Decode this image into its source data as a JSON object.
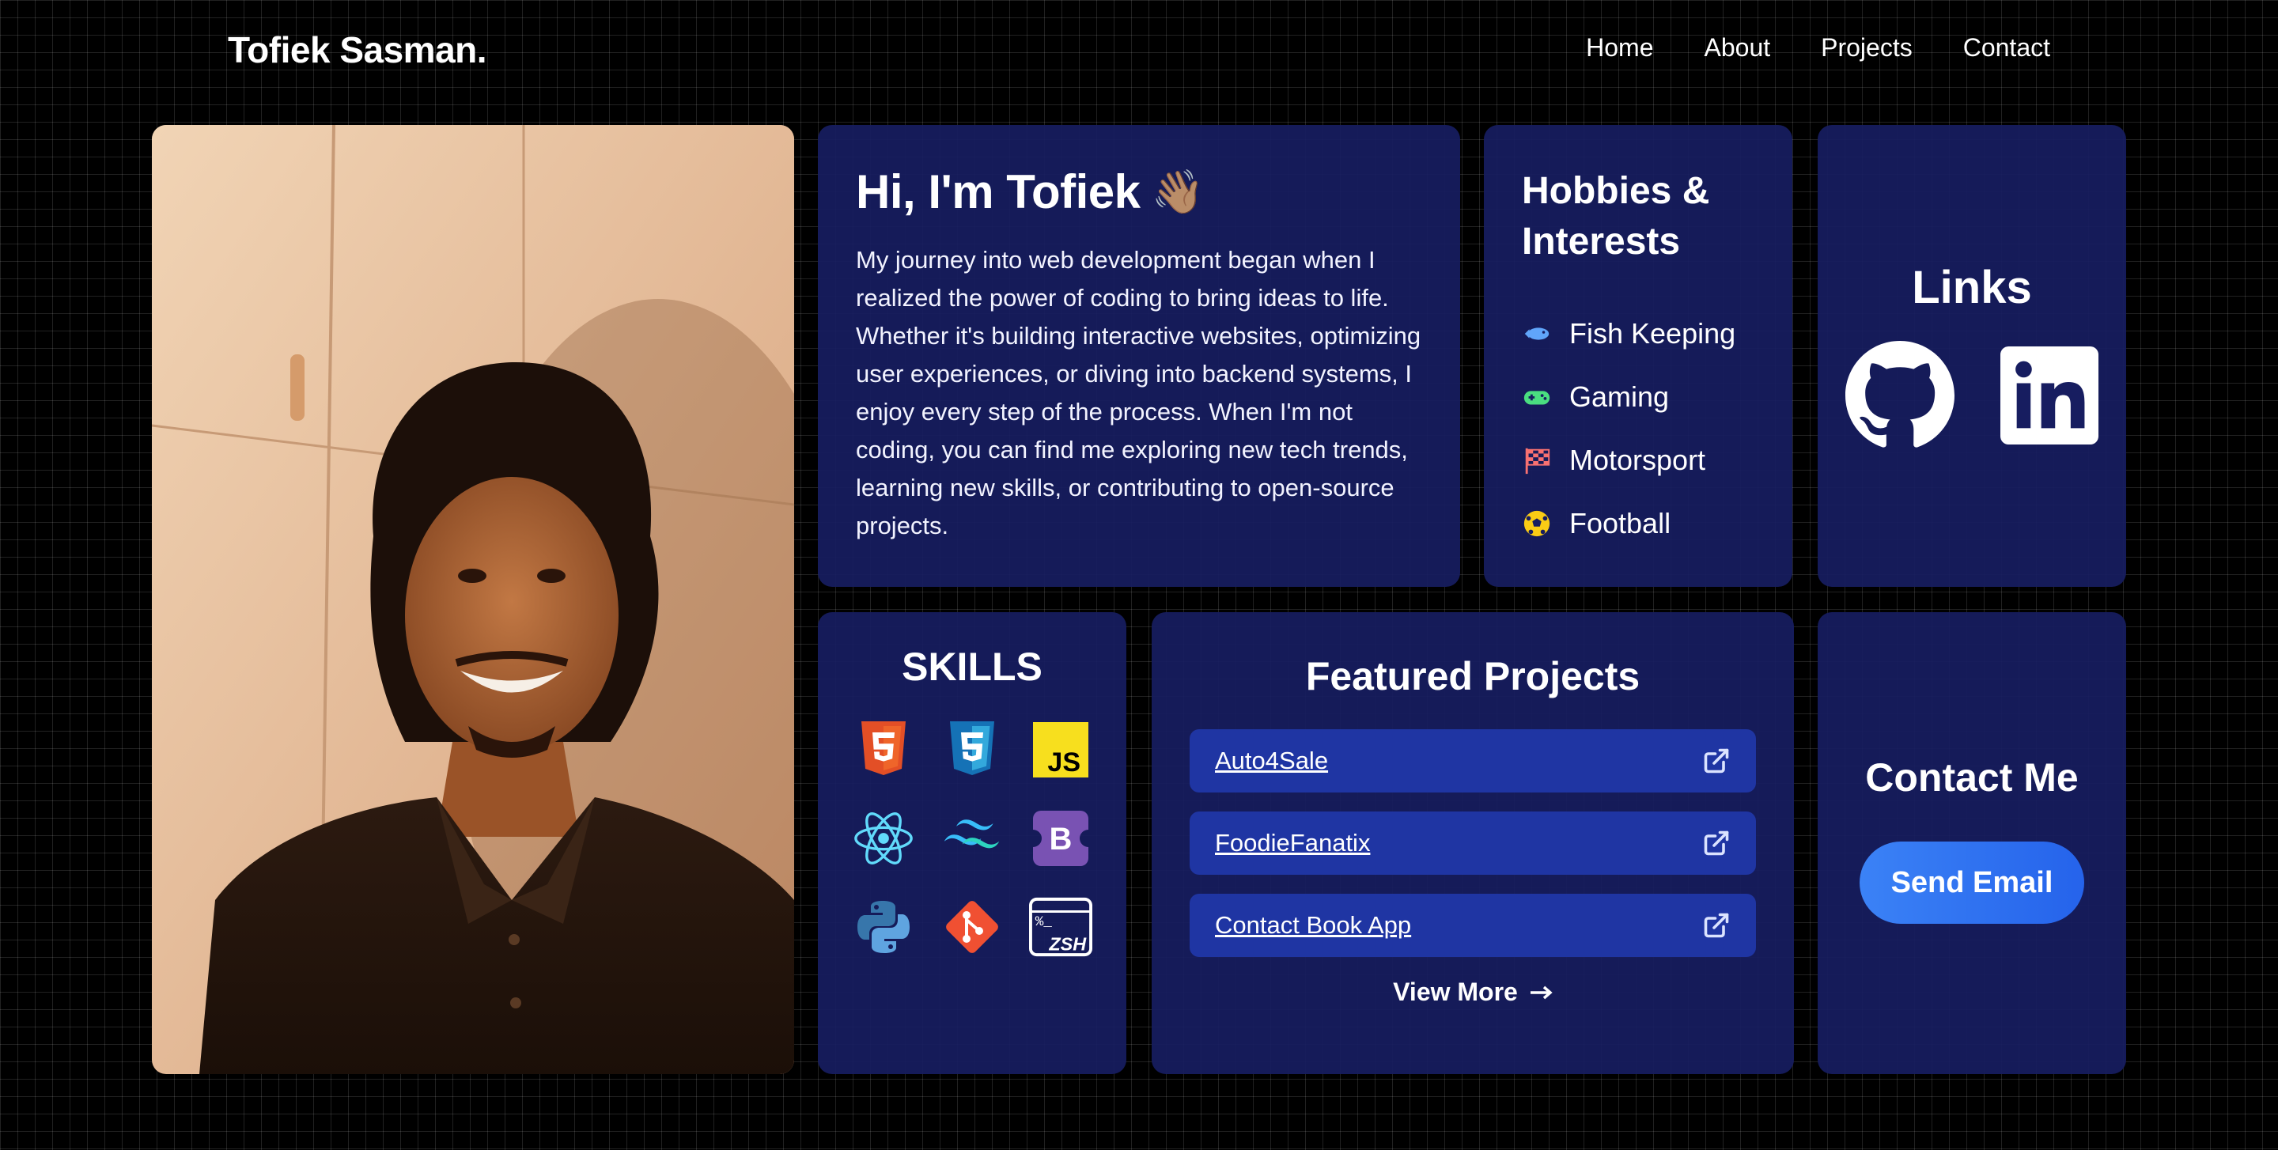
{
  "header": {
    "brand": "Tofiek Sasman.",
    "nav": [
      "Home",
      "About",
      "Projects",
      "Contact"
    ]
  },
  "about": {
    "greeting": "Hi, I'm Tofiek",
    "emoji": "👋🏽",
    "bio": "My journey into web development began when I realized the power of coding to bring ideas to life. Whether it's building interactive websites, optimizing user experiences, or diving into backend systems, I enjoy every step of the process. When I'm not coding, you can find me exploring new tech trends, learning new skills, or contributing to open-source projects."
  },
  "hobbies": {
    "title": "Hobbies & Interests",
    "items": [
      {
        "label": "Fish Keeping",
        "icon": "fish-icon",
        "color": "#60a5fa"
      },
      {
        "label": "Gaming",
        "icon": "gamepad-icon",
        "color": "#4ade80"
      },
      {
        "label": "Motorsport",
        "icon": "checkered-flag-icon",
        "color": "#f87171"
      },
      {
        "label": "Football",
        "icon": "football-icon",
        "color": "#facc15"
      }
    ]
  },
  "links": {
    "title": "Links",
    "items": [
      "github-icon",
      "linkedin-icon"
    ]
  },
  "skills": {
    "title": "SKILLS",
    "icons": [
      "html5-icon",
      "css3-icon",
      "javascript-icon",
      "react-icon",
      "tailwind-icon",
      "bootstrap-icon",
      "python-icon",
      "git-icon",
      "zsh-terminal-icon"
    ],
    "js_label": "JS",
    "bootstrap_label": "B",
    "zsh_label": "ZSH",
    "zsh_prompt": "%_"
  },
  "projects": {
    "title": "Featured Projects",
    "items": [
      "Auto4Sale",
      "FoodieFanatix",
      "Contact Book App"
    ],
    "view_more": "View More"
  },
  "contact": {
    "title": "Contact Me",
    "button": "Send Email"
  },
  "colors": {
    "card": "#171d60",
    "project_item": "#1f35a3",
    "button": "#2563eb"
  }
}
